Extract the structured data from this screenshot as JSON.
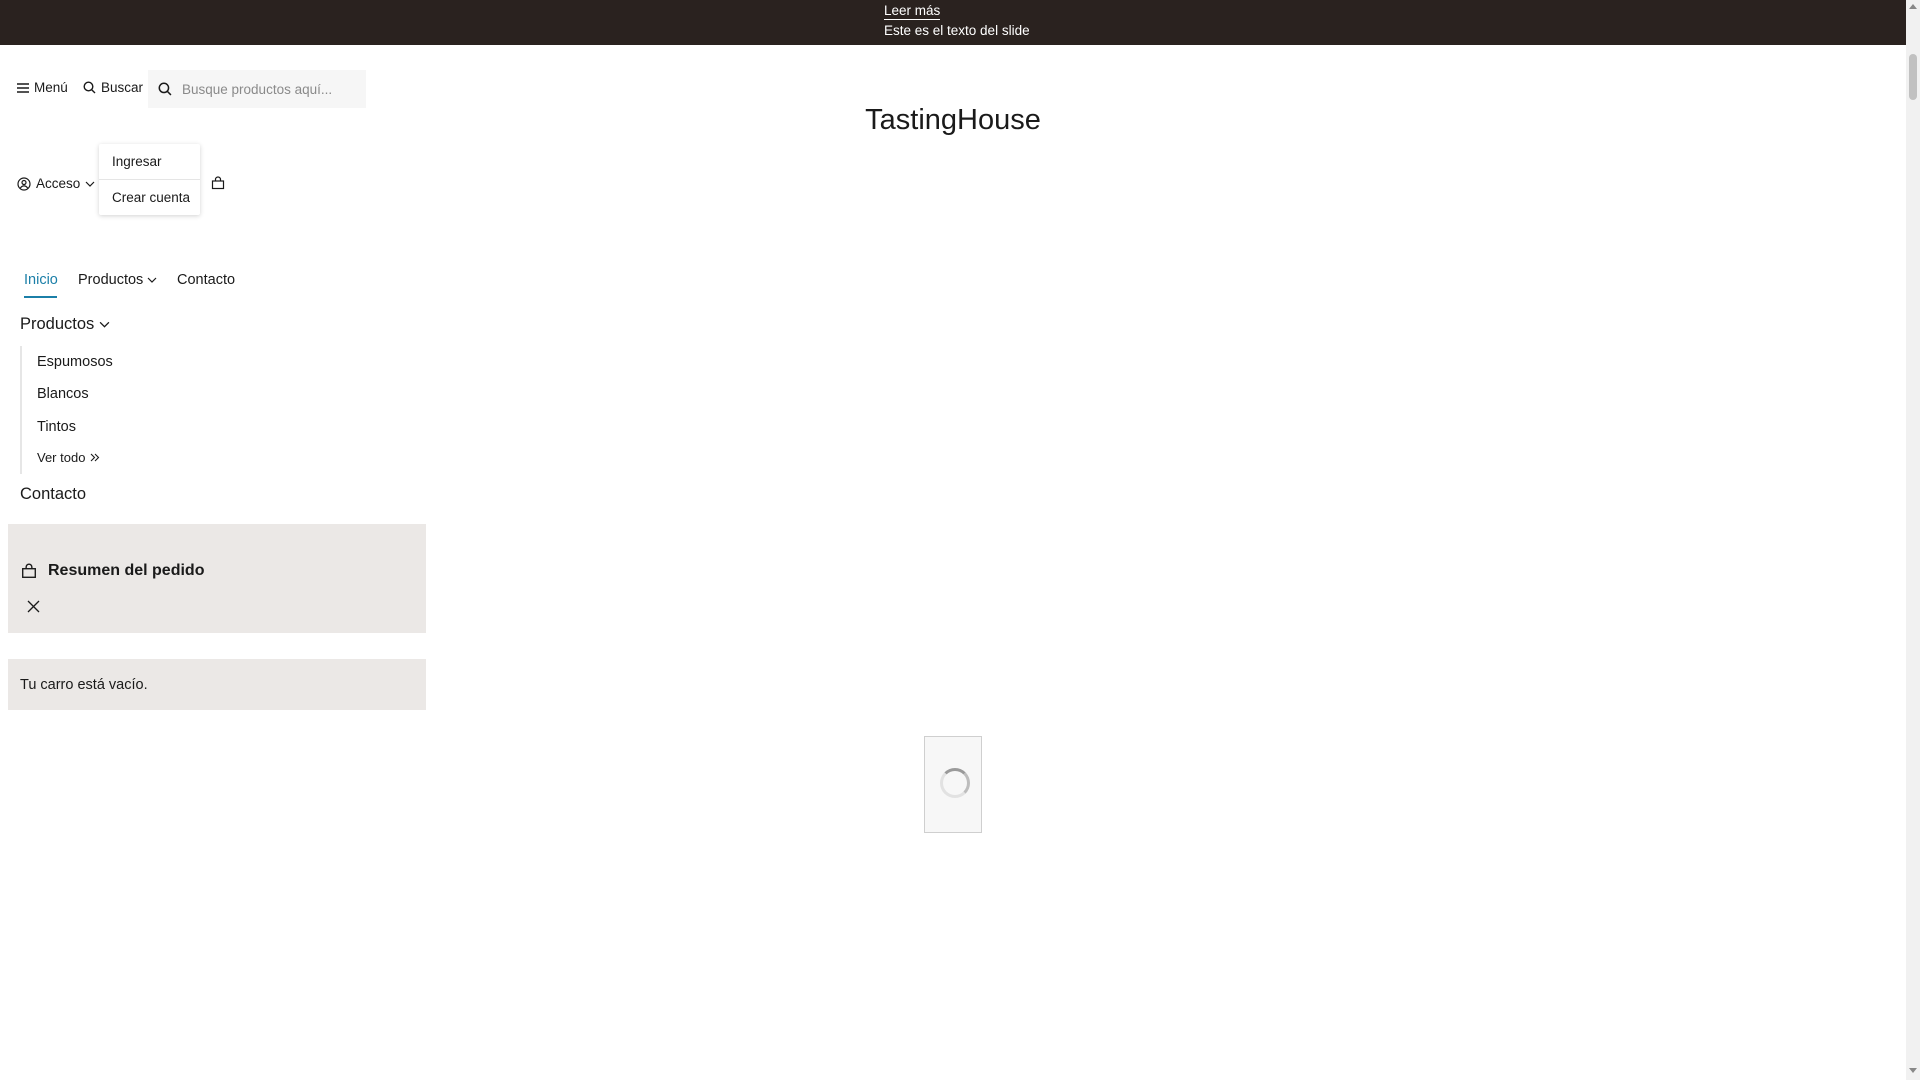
{
  "announcement": {
    "link": "Leer más",
    "text": "Este es el texto del slide"
  },
  "header": {
    "menu_label": "Menú",
    "search_label": "Buscar",
    "search_placeholder": "Busque productos aquí...",
    "brand": "TastingHouse",
    "account_label": "Acceso",
    "account_menu": [
      "Ingresar",
      "Crear cuenta"
    ]
  },
  "nav": {
    "items": [
      "Inicio",
      "Productos",
      "Contacto"
    ],
    "active": "Inicio"
  },
  "mobile_menu": {
    "products_title": "Productos",
    "products_items": [
      "Espumosos",
      "Blancos",
      "Tintos"
    ],
    "see_all": "Ver todo",
    "contact": "Contacto"
  },
  "cart": {
    "title": "Resumen del pedido",
    "empty_text": "Tu carro está vacío."
  },
  "colors": {
    "topbar": "#2a221f",
    "accent": "#1b7fa8",
    "panel": "#ebe8e6"
  },
  "icons": [
    "menu-icon",
    "search-icon",
    "user-circle-icon",
    "chevron-down-icon",
    "bag-icon",
    "double-chevron-right-icon",
    "close-icon",
    "loading-spinner"
  ]
}
